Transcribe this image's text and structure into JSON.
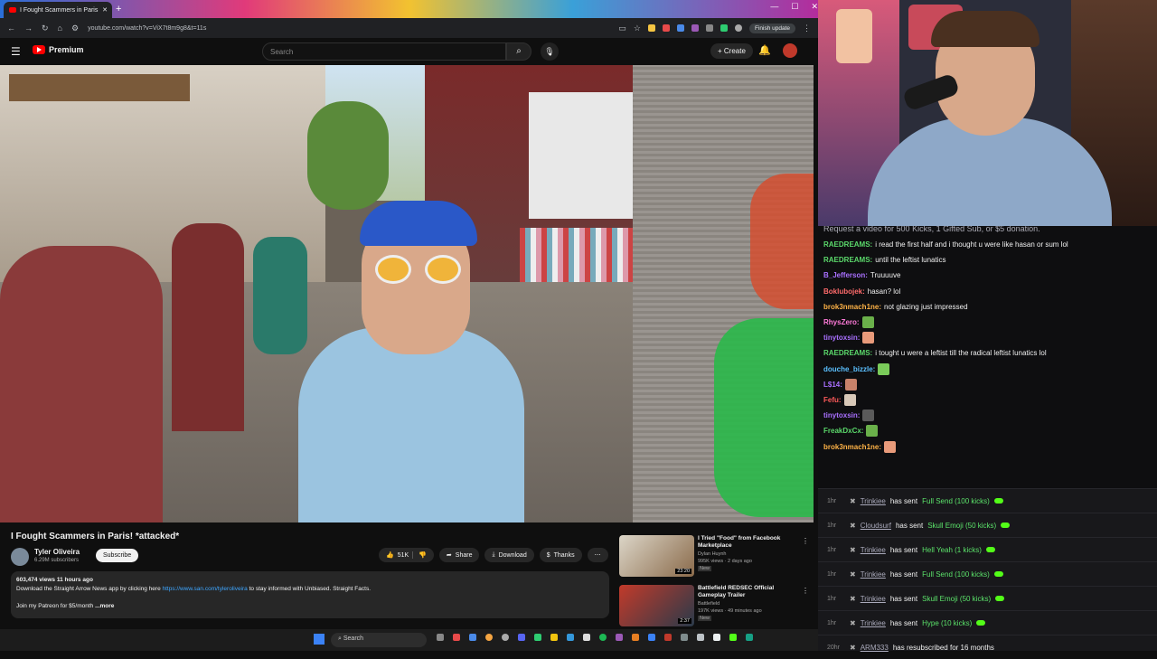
{
  "browser": {
    "tab_title": "I Fought Scammers in Paris",
    "url": "youtube.com/watch?v=ViX7t8m9g8&t=11s",
    "finish_update": "Finish update"
  },
  "youtube": {
    "logo": "Premium",
    "search_placeholder": "Search",
    "create": "Create"
  },
  "video": {
    "title": "I Fought Scammers in Paris! *attacked*",
    "channel": "Tyler Oliveira",
    "subscribers": "6.29M subscribers",
    "subscribe": "Subscribe",
    "likes": "51K",
    "share": "Share",
    "download": "Download",
    "thanks": "Thanks",
    "meta": "603,474 views  11 hours ago",
    "desc_prefix": "Download the Straight Arrow News app by clicking here ",
    "desc_link": "https://www.san.com/tyleroliveira",
    "desc_suffix": " to stay informed with Unbiased. Straight Facts.",
    "desc_line2": "Join my Patreon for $5/month",
    "desc_more": "...more"
  },
  "related": [
    {
      "title": "I Tried \"Food\" from Facebook Marketplace",
      "channel": "Dylan Huynh",
      "stats": "995K views · 2 days ago",
      "badge": "New",
      "duration": "23:20"
    },
    {
      "title": "Battlefield REDSEC Official Gameplay Trailer",
      "channel": "Battlefield",
      "stats": "197K views · 49 minutes ago",
      "badge": "New",
      "duration": "2:37"
    }
  ],
  "taskbar": {
    "search": "Search"
  },
  "chat": {
    "notice": "Request a video for 500 Kicks, 1 Gifted Sub, or $5 donation.",
    "messages": [
      {
        "user": "RAEDREAMS:",
        "color": "#5bd96b",
        "text": "i read the first half and i thought u were like hasan or sum lol"
      },
      {
        "user": "RAEDREAMS:",
        "color": "#5bd96b",
        "text": "until the leftist lunatics"
      },
      {
        "user": "B_Jefferson:",
        "color": "#a970ff",
        "text": "Truuuuve"
      },
      {
        "user": "Boklubojek:",
        "color": "#ff6b6b",
        "text": "hasan? lol"
      },
      {
        "user": "brok3nmach1ne:",
        "color": "#ffb347",
        "text": "not glazing just impressed"
      },
      {
        "user": "RhysZero:",
        "color": "#ff7ad9",
        "text": ""
      },
      {
        "user": "tinytoxsin:",
        "color": "#a970ff",
        "text": ""
      },
      {
        "user": "RAEDREAMS:",
        "color": "#5bd96b",
        "text": "i tought u were a leftist till the radical leftist lunatics lol"
      },
      {
        "user": "douche_bizzle:",
        "color": "#5bc0ff",
        "text": ""
      },
      {
        "user": "L$14:",
        "color": "#a970ff",
        "text": ""
      },
      {
        "user": "Fefu:",
        "color": "#ff5a5a",
        "text": ""
      },
      {
        "user": "tinytoxsin:",
        "color": "#a970ff",
        "text": ""
      },
      {
        "user": "FreakDxCx:",
        "color": "#5bd96b",
        "text": ""
      },
      {
        "user": "brok3nmach1ne:",
        "color": "#ffb347",
        "text": ""
      }
    ]
  },
  "events": [
    {
      "time": "1hr",
      "user": "Trinkiee",
      "mid": "has sent",
      "item": "Full Send (100 kicks)"
    },
    {
      "time": "1hr",
      "user": "Cloudsurf",
      "mid": "has sent",
      "item": "Skull Emoji (50 kicks)"
    },
    {
      "time": "1hr",
      "user": "Trinkiee",
      "mid": "has sent",
      "item": "Hell Yeah (1 kicks)"
    },
    {
      "time": "1hr",
      "user": "Trinkiee",
      "mid": "has sent",
      "item": "Full Send (100 kicks)"
    },
    {
      "time": "1hr",
      "user": "Trinkiee",
      "mid": "has sent",
      "item": "Skull Emoji (50 kicks)"
    },
    {
      "time": "1hr",
      "user": "Trinkiee",
      "mid": "has sent",
      "item": "Hype (10 kicks)"
    },
    {
      "time": "20hr",
      "user": "ARM333",
      "mid": "has resubscribed for 16 months",
      "item": ""
    }
  ]
}
